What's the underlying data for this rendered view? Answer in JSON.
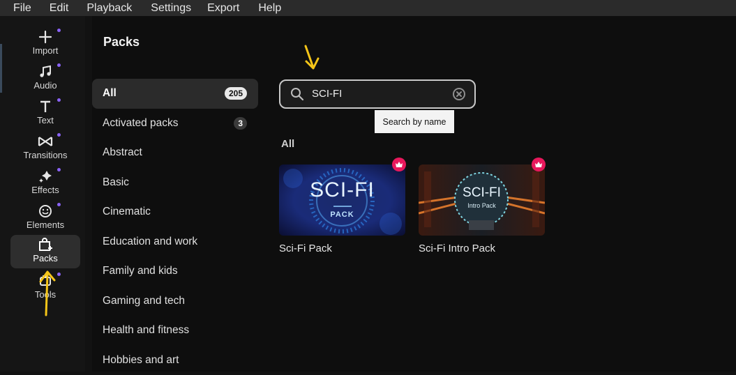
{
  "menu": [
    "File",
    "Edit",
    "Playback",
    "Settings",
    "Export",
    "Help"
  ],
  "sidebar": {
    "items": [
      {
        "label": "Import",
        "icon": "plus-icon"
      },
      {
        "label": "Audio",
        "icon": "music-note-icon"
      },
      {
        "label": "Text",
        "icon": "text-icon"
      },
      {
        "label": "Transitions",
        "icon": "transitions-icon"
      },
      {
        "label": "Effects",
        "icon": "sparkle-icon"
      },
      {
        "label": "Elements",
        "icon": "smiley-icon"
      },
      {
        "label": "Packs",
        "icon": "packs-bag-icon",
        "active": true
      },
      {
        "label": "Tools",
        "icon": "tools-icon"
      }
    ]
  },
  "page": {
    "title": "Packs"
  },
  "categories": [
    {
      "label": "All",
      "count": "205",
      "active": true
    },
    {
      "label": "Activated packs",
      "count": "3"
    },
    {
      "label": "Abstract"
    },
    {
      "label": "Basic"
    },
    {
      "label": "Cinematic"
    },
    {
      "label": "Education and work"
    },
    {
      "label": "Family and kids"
    },
    {
      "label": "Gaming and tech"
    },
    {
      "label": "Health and fitness"
    },
    {
      "label": "Hobbies and art"
    }
  ],
  "search": {
    "value": "SCI-FI",
    "tooltip": "Search by name"
  },
  "results": {
    "section_label": "All",
    "packs": [
      {
        "name": "Sci-Fi Pack",
        "thumb_title": "SCI-FI",
        "thumb_subtitle": "PACK",
        "premium": true
      },
      {
        "name": "Sci-Fi Intro Pack",
        "thumb_title": "SCI-FI",
        "thumb_subtitle": "Intro Pack",
        "premium": true
      }
    ]
  },
  "colors": {
    "accent_dot": "#8a63f5",
    "crown_badge": "#e8185c",
    "annotation_arrow": "#f5c518"
  }
}
